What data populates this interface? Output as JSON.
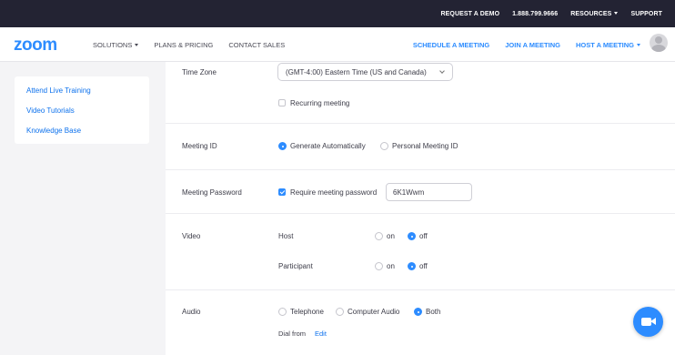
{
  "topbar": {
    "request_demo": "REQUEST A DEMO",
    "phone": "1.888.799.9666",
    "resources": "RESOURCES",
    "support": "SUPPORT"
  },
  "nav": {
    "logo": "zoom",
    "solutions": "SOLUTIONS",
    "plans": "PLANS & PRICING",
    "contact": "CONTACT SALES",
    "schedule": "SCHEDULE A MEETING",
    "join": "JOIN A MEETING",
    "host": "HOST A MEETING"
  },
  "sidebar": {
    "items": [
      "Attend Live Training",
      "Video Tutorials",
      "Knowledge Base"
    ]
  },
  "form": {
    "time_zone": {
      "label": "Time Zone",
      "value": "(GMT-4:00) Eastern Time (US and Canada)"
    },
    "recurring": {
      "label": "Recurring meeting",
      "checked": false
    },
    "meeting_id": {
      "label": "Meeting ID",
      "options": [
        "Generate Automatically",
        "Personal Meeting ID"
      ],
      "selected": "Generate Automatically"
    },
    "password": {
      "label": "Meeting Password",
      "checkbox_label": "Require meeting password",
      "checked": true,
      "value": "6K1Wwm"
    },
    "video": {
      "label": "Video",
      "host_label": "Host",
      "participant_label": "Participant",
      "on": "on",
      "off": "off",
      "host_selected": "off",
      "participant_selected": "off"
    },
    "audio": {
      "label": "Audio",
      "options": [
        "Telephone",
        "Computer Audio",
        "Both"
      ],
      "selected": "Both",
      "dial_from": "Dial from",
      "edit": "Edit"
    }
  },
  "colors": {
    "accent": "#2d8cff",
    "topbar": "#232333"
  }
}
